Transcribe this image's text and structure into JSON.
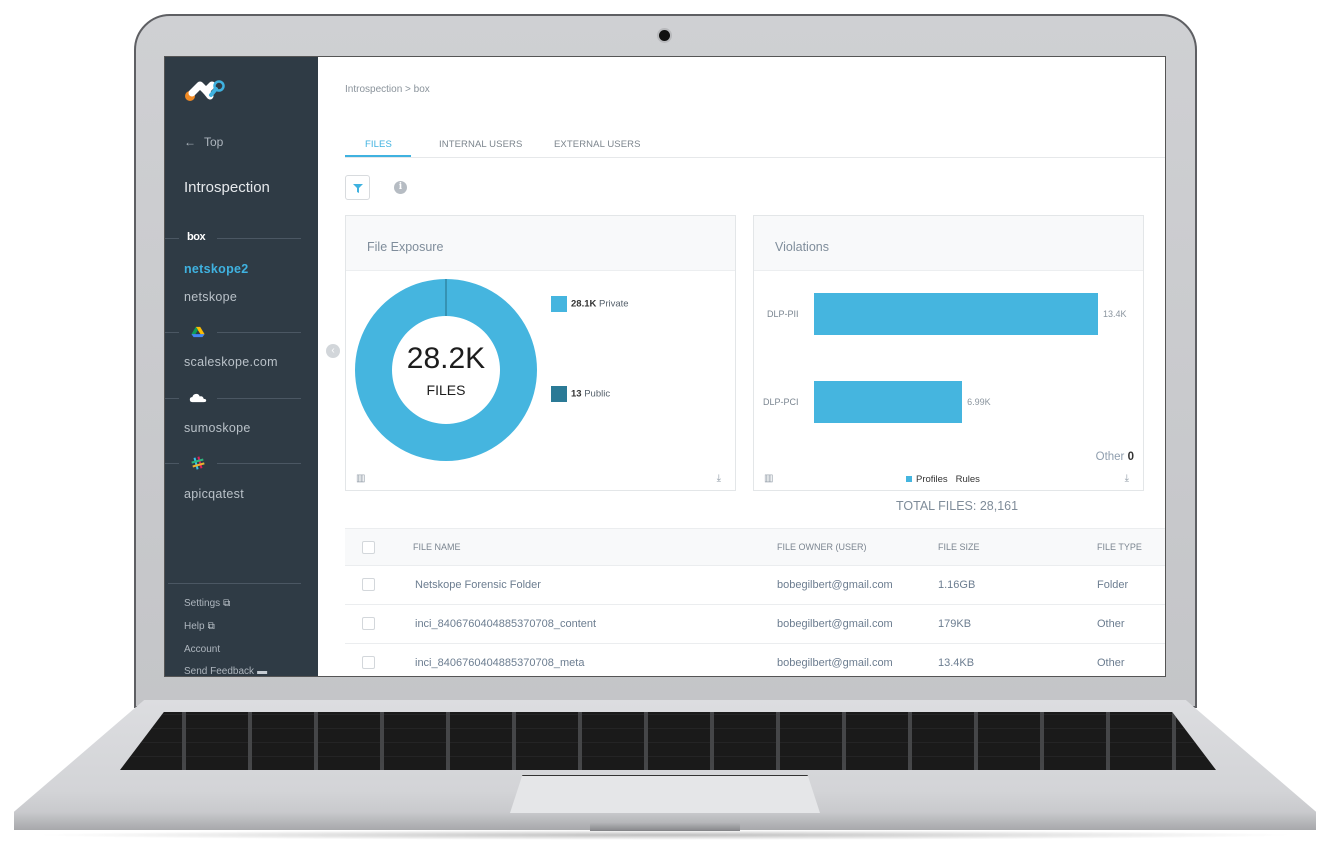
{
  "sidebar": {
    "back_label": "Top",
    "section_title": "Introspection",
    "services": [
      {
        "icon": "box-logo-icon",
        "label": "box",
        "instances": [
          {
            "label": "netskope2",
            "active": true
          },
          {
            "label": "netskope",
            "active": false
          }
        ]
      },
      {
        "icon": "google-drive-icon",
        "label": "",
        "instances": [
          {
            "label": "scaleskope.com",
            "active": false
          }
        ]
      },
      {
        "icon": "onedrive-cloud-icon",
        "label": "",
        "instances": [
          {
            "label": "sumoskope",
            "active": false
          }
        ]
      },
      {
        "icon": "slack-icon",
        "label": "",
        "instances": [
          {
            "label": "apicqatest",
            "active": false
          }
        ]
      }
    ],
    "bottom_links": {
      "settings": "Settings",
      "help": "Help",
      "account": "Account",
      "feedback": "Send Feedback"
    }
  },
  "main": {
    "breadcrumb": "Introspection > box",
    "tabs": [
      {
        "label": "FILES",
        "active": true
      },
      {
        "label": "INTERNAL USERS",
        "active": false
      },
      {
        "label": "EXTERNAL USERS",
        "active": false
      }
    ],
    "info_glyph": "i",
    "collapse_glyph": "‹",
    "file_exposure": {
      "title": "File Exposure",
      "center_value": "28.2K",
      "center_label": "FILES",
      "legend": [
        {
          "value": "28.1K",
          "label": "Private",
          "color": "#45b5df"
        },
        {
          "value": "13",
          "label": "Public",
          "color": "#2b7a96"
        }
      ]
    },
    "violations": {
      "title": "Violations",
      "other_label": "Other",
      "other_value": "0",
      "legend": {
        "profiles": "Profiles",
        "rules": "Rules"
      }
    },
    "total_files": "TOTAL FILES: 28,161",
    "table": {
      "headers": {
        "name": "FILE NAME",
        "owner": "FILE OWNER (USER)",
        "size": "FILE SIZE",
        "type": "FILE TYPE"
      },
      "rows": [
        {
          "name": "Netskope Forensic Folder",
          "owner": "bobegilbert@gmail.com",
          "size": "1.16GB",
          "type": "Folder"
        },
        {
          "name": "inci_8406760404885370708_content",
          "owner": "bobegilbert@gmail.com",
          "size": "179KB",
          "type": "Other"
        },
        {
          "name": "inci_8406760404885370708_meta",
          "owner": "bobegilbert@gmail.com",
          "size": "13.4KB",
          "type": "Other"
        }
      ]
    }
  },
  "chart_data": [
    {
      "type": "pie",
      "title": "File Exposure",
      "categories": [
        "Private",
        "Public"
      ],
      "values": [
        28148,
        13
      ],
      "display_values": [
        "28.1K",
        "13"
      ],
      "total_label": "28.2K FILES",
      "colors": [
        "#45b5df",
        "#2b7a96"
      ],
      "legend": "right"
    },
    {
      "type": "bar",
      "orientation": "horizontal",
      "title": "Violations",
      "categories": [
        "DLP-PII",
        "DLP-PCI"
      ],
      "values": [
        13400,
        6990
      ],
      "display_values": [
        "13.4K",
        "6.99K"
      ],
      "series_name": "Profiles",
      "color": "#45b5df",
      "xlim": [
        0,
        13400
      ],
      "legend": "bottom"
    }
  ]
}
